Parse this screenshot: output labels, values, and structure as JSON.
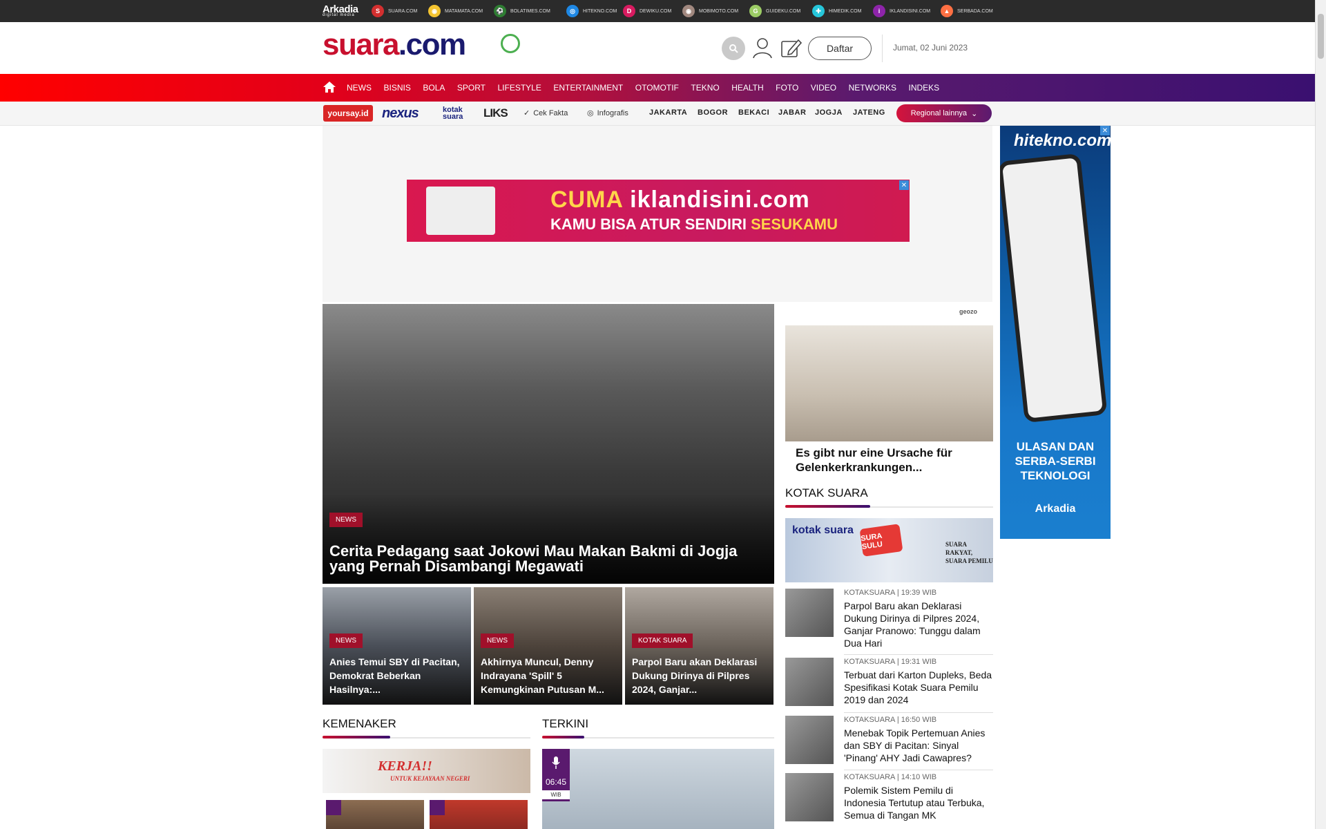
{
  "network": {
    "brand": "Arkadia",
    "brand_sub": "digital media",
    "sites": [
      {
        "label": "SUARA.COM",
        "icon": "S",
        "color": "#d32f2f"
      },
      {
        "label": "MATAMATA.COM",
        "icon": "◉",
        "color": "#f4c430"
      },
      {
        "label": "BOLATIMES.COM",
        "icon": "⚽",
        "color": "#2e7d32"
      },
      {
        "label": "HITEKNO.COM",
        "icon": "◎",
        "color": "#1e88e5"
      },
      {
        "label": "DEWIKU.COM",
        "icon": "D",
        "color": "#d81b60"
      },
      {
        "label": "MOBIMOTO.COM",
        "icon": "◉",
        "color": "#a1887f"
      },
      {
        "label": "GUIDEKU.COM",
        "icon": "G",
        "color": "#9ccc65"
      },
      {
        "label": "HIMEDIK.COM",
        "icon": "✚",
        "color": "#26c6da"
      },
      {
        "label": "IKLANDISINI.COM",
        "icon": "i",
        "color": "#8e24aa"
      },
      {
        "label": "SERBADA.COM",
        "icon": "▲",
        "color": "#ff7043"
      }
    ]
  },
  "header": {
    "logo_main": "suara",
    "logo_tld": ".com",
    "register_label": "Daftar",
    "date": "Jumat, 02 Juni 2023"
  },
  "nav": {
    "items": [
      "NEWS",
      "BISNIS",
      "BOLA",
      "SPORT",
      "LIFESTYLE",
      "ENTERTAINMENT",
      "OTOMOTIF",
      "TEKNO",
      "HEALTH",
      "FOTO",
      "VIDEO",
      "NETWORKS",
      "INDEKS"
    ]
  },
  "subnav": {
    "brands": {
      "yoursay": "yoursay.id",
      "nexus": "nexus",
      "kotak": "kotak suara",
      "liks": "LIKS"
    },
    "links": {
      "cek_fakta": "Cek Fakta",
      "infografis": "Infografis"
    },
    "cities": [
      "JAKARTA",
      "BOGOR",
      "BEKACI",
      "JABAR",
      "JOGJA",
      "JATENG"
    ],
    "regional": "Regional lainnya"
  },
  "ads": {
    "top_line1_a": "CUMA ",
    "top_line1_b": "iklandisini",
    "top_line1_c": ".com",
    "top_line2_a": "KAMU BISA ATUR SENDIRI ",
    "top_line2_b": "SESUKAMU",
    "sky_brand": "hitekno.com",
    "sky_text": "ULASAN DAN SERBA-SERBI TEKNOLOGI",
    "sky_footer": "Arkadia",
    "close": "✕"
  },
  "hero": {
    "badge": "NEWS",
    "title": "Cerita Pedagang saat Jokowi Mau Makan Bakmi di Jogja yang Pernah Disambangi Megawati"
  },
  "cards": [
    {
      "badge": "NEWS",
      "title": "Anies Temui SBY di Pacitan, Demokrat Beberkan Hasilnya:..."
    },
    {
      "badge": "NEWS",
      "title": "Akhirnya Muncul, Denny Indrayana 'Spill' 5 Kemungkinan Putusan M..."
    },
    {
      "badge": "KOTAK SUARA",
      "title": "Parpol Baru akan Deklarasi Dukung Dirinya di Pilpres 2024, Ganjar..."
    }
  ],
  "promo": {
    "sponsor": "geozo",
    "title": "Es gibt nur eine Ursache für Gelenkerkrankungen..."
  },
  "kotak_suara": {
    "title": "KOTAK SUARA",
    "banner_logo": "kotak suara",
    "banner_badge": "SURA SULU",
    "banner_slogan": "SUARA RAKYAT, SUARA PEMILU",
    "items": [
      {
        "meta": "KOTAKSUARA | 19:39 WIB",
        "title": "Parpol Baru akan Deklarasi Dukung Dirinya di Pilpres 2024, Ganjar Pranowo: Tunggu dalam Dua Hari"
      },
      {
        "meta": "KOTAKSUARA | 19:31 WIB",
        "title": "Terbuat dari Karton Dupleks, Beda Spesifikasi Kotak Suara Pemilu 2019 dan 2024"
      },
      {
        "meta": "KOTAKSUARA | 16:50 WIB",
        "title": "Menebak Topik Pertemuan Anies dan SBY di Pacitan: Sinyal 'Pinang' AHY Jadi Cawapres?"
      },
      {
        "meta": "KOTAKSUARA | 14:10 WIB",
        "title": "Polemik Sistem Pemilu di Indonesia Tertutup atau Terbuka, Semua di Tangan MK"
      }
    ]
  },
  "kemenaker": {
    "title": "KEMENAKER",
    "banner_text": "KERJA!!",
    "banner_sub": "UNTUK KEJAYAAN NEGERI"
  },
  "terkini": {
    "title": "TERKINI",
    "time": "06:45",
    "tz": "WIB"
  }
}
